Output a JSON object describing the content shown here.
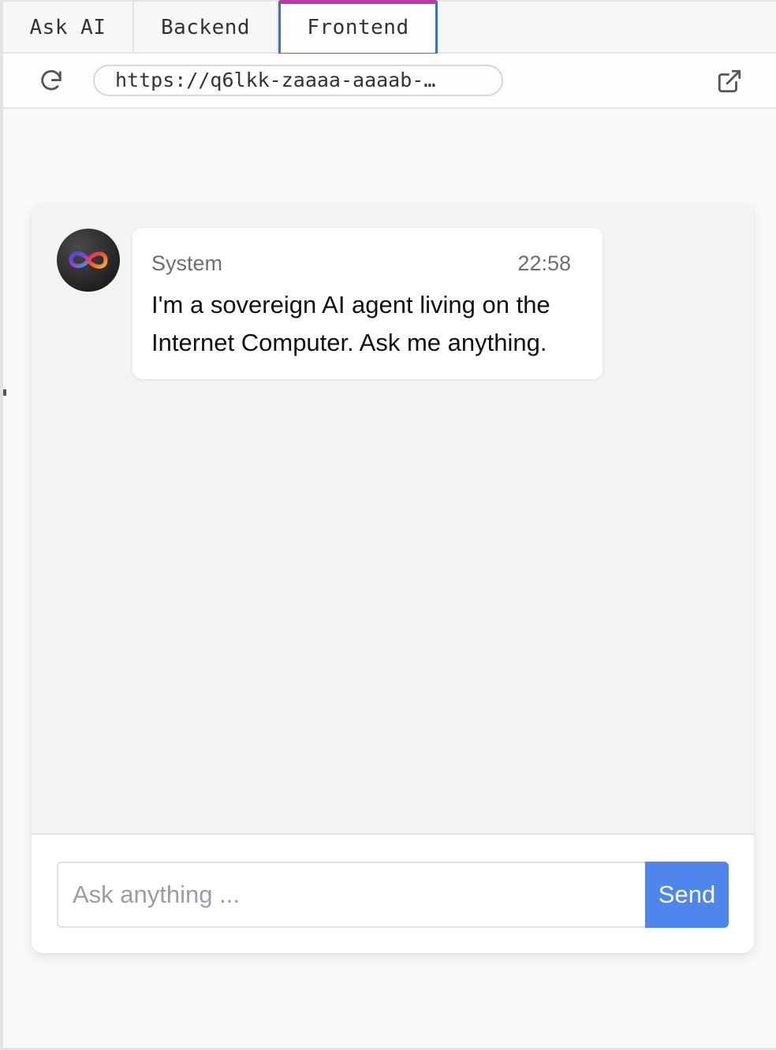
{
  "tabs": [
    {
      "label": "Ask AI",
      "active": false
    },
    {
      "label": "Backend",
      "active": false
    },
    {
      "label": "Frontend",
      "active": true
    }
  ],
  "urlbar": {
    "url": "https://q6lkk-zaaaa-aaaab-…",
    "refresh_icon": "refresh-icon",
    "external_icon": "external-link-icon"
  },
  "chat": {
    "messages": [
      {
        "sender": "System",
        "time": "22:58",
        "text": "I'm a sovereign AI agent living on the Internet Computer. Ask me anything.",
        "avatar_icon": "infinity-logo-icon"
      }
    ],
    "input_placeholder": "Ask anything ...",
    "send_label": "Send"
  },
  "colors": {
    "active_tab_border": "#3b6fd1",
    "active_tab_top": "#c13aa1",
    "send_button": "#4f86ee",
    "messages_bg": "#f2f3f5"
  }
}
